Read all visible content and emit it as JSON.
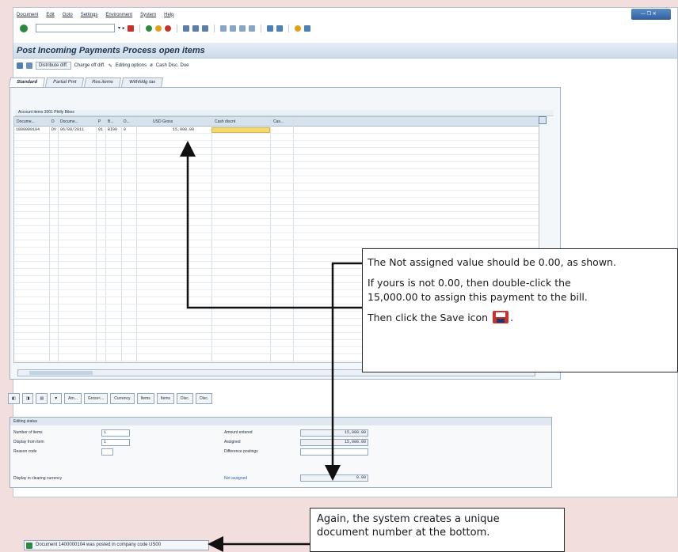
{
  "menu": [
    "Document",
    "Edit",
    "Goto",
    "Settings",
    "Environment",
    "System",
    "Help"
  ],
  "page_title": "Post Incoming Payments Process open items",
  "app_toolbar": {
    "distribute": "Distribute diff.",
    "charge_off": "Charge off diff.",
    "editing_options": "Editing options",
    "cash_disc_due": "Cash Disc. Due"
  },
  "tabs": [
    "Standard",
    "Partial Pmt",
    "Res.items",
    "Withhldg tax"
  ],
  "grid": {
    "title": "Account items 3001 Philly Bikes",
    "headers": [
      "Docume...",
      "D",
      "Docume...",
      "P",
      "B...",
      "D...",
      "USD Gross",
      "Cash discnt",
      "Cas..."
    ],
    "row": [
      "1800000104",
      "DV",
      "06/09/2011",
      "01",
      "BI00",
      "0",
      "15,000.00"
    ]
  },
  "button_bar": [
    "Am...",
    "Gross<...",
    "Currency",
    "Items",
    "Items",
    "Disc.",
    "Disc."
  ],
  "editing_status": {
    "title": "Editing status",
    "number_of_items_label": "Number of items",
    "number_of_items": "1",
    "display_from_label": "Display from item",
    "display_from": "1",
    "reason_code_label": "Reason code",
    "display_clearing_label": "Display in clearing currency",
    "amount_entered_label": "Amount entered",
    "amount_entered": "15,000.00",
    "assigned_label": "Assigned",
    "assigned": "15,000.00",
    "difference_label": "Difference postings",
    "not_assigned_label": "Not assigned",
    "not_assigned": "0.00"
  },
  "status_bar": "Document 1400000104 was posted in company code US00",
  "callout1": {
    "line1": "The Not assigned value should be 0.00,  as shown.",
    "line2": "If yours is not 0.00, then double-click the",
    "line3": "15,000.00 to assign this payment to the bill.",
    "line4_pre": "Then click the Save icon",
    "line4_post": "."
  },
  "callout2": {
    "line1": "Again, the system creates a unique",
    "line2": "document number at the bottom."
  },
  "colors": {
    "highlight": "#f4d86b",
    "title_bg": "#cddbe8",
    "status_ok": "#2b8a3e"
  }
}
